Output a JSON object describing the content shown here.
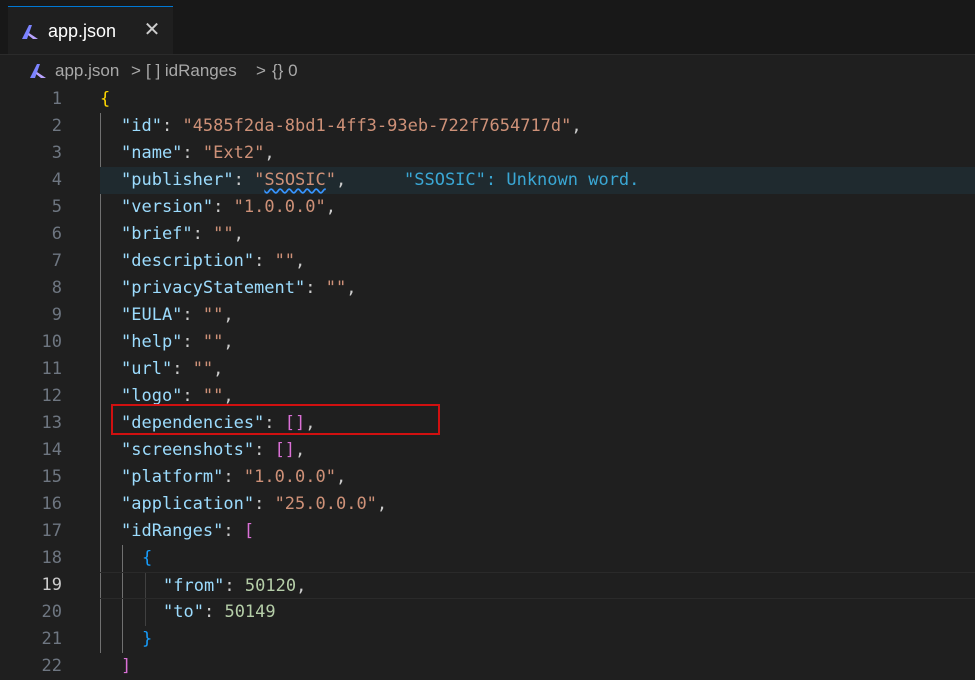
{
  "tab": {
    "label": "app.json",
    "icon": "al-language-icon",
    "close_glyph": "✕"
  },
  "breadcrumb": {
    "file": "app.json",
    "sep1": ">",
    "seg2": "[ ] idRanges",
    "sep2": ">",
    "seg3": "{} 0"
  },
  "editor": {
    "current_line": 19,
    "highlighted_key": "dependencies",
    "diagnostic": "\"SSOSIC\": Unknown word.",
    "lines": [
      {
        "n": "1"
      },
      {
        "n": "2"
      },
      {
        "n": "3"
      },
      {
        "n": "4"
      },
      {
        "n": "5"
      },
      {
        "n": "6"
      },
      {
        "n": "7"
      },
      {
        "n": "8"
      },
      {
        "n": "9"
      },
      {
        "n": "10"
      },
      {
        "n": "11"
      },
      {
        "n": "12"
      },
      {
        "n": "13"
      },
      {
        "n": "14"
      },
      {
        "n": "15"
      },
      {
        "n": "16"
      },
      {
        "n": "17"
      },
      {
        "n": "18"
      },
      {
        "n": "19"
      },
      {
        "n": "20"
      },
      {
        "n": "21"
      },
      {
        "n": "22"
      }
    ],
    "tokens": {
      "l1_brace": "{",
      "l2_key": "\"id\"",
      "l2_val": "\"4585f2da-8bd1-4ff3-93eb-722f7654717d\"",
      "l3_key": "\"name\"",
      "l3_val": "\"Ext2\"",
      "l4_key": "\"publisher\"",
      "l4_val_open": "\"",
      "l4_val_word": "SSOSIC",
      "l4_val_close": "\"",
      "l5_key": "\"version\"",
      "l5_val": "\"1.0.0.0\"",
      "l6_key": "\"brief\"",
      "l6_val": "\"\"",
      "l7_key": "\"description\"",
      "l7_val": "\"\"",
      "l8_key": "\"privacyStatement\"",
      "l8_val": "\"\"",
      "l9_key": "\"EULA\"",
      "l9_val": "\"\"",
      "l10_key": "\"help\"",
      "l10_val": "\"\"",
      "l11_key": "\"url\"",
      "l11_val": "\"\"",
      "l12_key": "\"logo\"",
      "l12_val": "\"\"",
      "l13_key": "\"dependencies\"",
      "l13_val": "[]",
      "l14_key": "\"screenshots\"",
      "l14_val": "[]",
      "l15_key": "\"platform\"",
      "l15_val": "\"1.0.0.0\"",
      "l16_key": "\"application\"",
      "l16_val": "\"25.0.0.0\"",
      "l17_key": "\"idRanges\"",
      "l17_open": "[",
      "l18_open": "{",
      "l19_key": "\"from\"",
      "l19_val": "50120",
      "l20_key": "\"to\"",
      "l20_val": "50149",
      "l21_close": "}",
      "l22_close": "]",
      "colon": ":",
      "comma": ","
    }
  },
  "colors": {
    "key": "#9cdcfe",
    "string": "#ce9178",
    "number": "#b5cea8",
    "bracket_level1": "#ffd700",
    "bracket_level2": "#da70d6",
    "bracket_level3": "#179fff",
    "highlight_box": "#d01010",
    "tab_accent": "#0078d4"
  }
}
